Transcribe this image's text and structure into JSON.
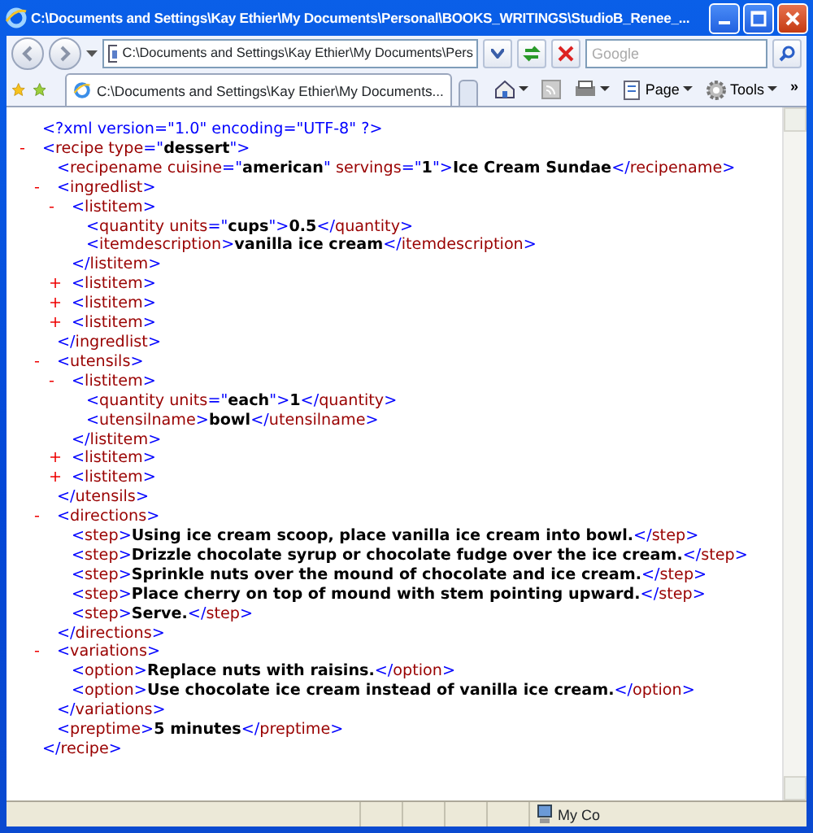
{
  "window": {
    "title": "C:\\Documents and Settings\\Kay Ethier\\My Documents\\Personal\\BOOKS_WRITINGS\\StudioB_Renee_..."
  },
  "address_bar": {
    "value": "C:\\Documents and Settings\\Kay Ethier\\My Documents\\Pers"
  },
  "search": {
    "placeholder": "Google"
  },
  "tabs": [
    {
      "label": "C:\\Documents and Settings\\Kay Ethier\\My Documents...",
      "selected": true
    }
  ],
  "command_bar": {
    "page": "Page",
    "tools": "Tools",
    "more": "»"
  },
  "syntax": {
    "open": "<",
    "close_open": "</",
    "end": ">",
    "eq": "=",
    "quote": "\"",
    "expanded": "-",
    "collapsed": "+"
  },
  "document": [
    {
      "kind": "pi",
      "text": "<?xml version=\"1.0\" encoding=\"UTF-8\" ?>"
    },
    {
      "kind": "element",
      "tag": "recipe",
      "attrs": [
        {
          "name": "type",
          "value": "dessert"
        }
      ],
      "expanded": true,
      "end_tag": "recipe",
      "children": [
        {
          "kind": "leaf",
          "tag": "recipename",
          "attrs": [
            {
              "name": "cuisine",
              "value": "american"
            },
            {
              "name": "servings",
              "value": "1"
            }
          ],
          "text": "Ice Cream Sundae",
          "end_tag": "recipename"
        },
        {
          "kind": "element",
          "tag": "ingredlist",
          "expanded": true,
          "end_tag": "ingredlist",
          "children": [
            {
              "kind": "element",
              "tag": "listitem",
              "expanded": true,
              "end_tag": "listitem",
              "children": [
                {
                  "kind": "leaf",
                  "tag": "quantity",
                  "attrs": [
                    {
                      "name": "units",
                      "value": "cups"
                    }
                  ],
                  "text": "0.5",
                  "end_tag": "quantity"
                },
                {
                  "kind": "leaf",
                  "tag": "itemdescription",
                  "text": "vanilla ice cream",
                  "end_tag": "itemdescription"
                }
              ]
            },
            {
              "kind": "element",
              "tag": "listitem",
              "expanded": false
            },
            {
              "kind": "element",
              "tag": "listitem",
              "expanded": false
            },
            {
              "kind": "element",
              "tag": "listitem",
              "expanded": false
            }
          ]
        },
        {
          "kind": "element",
          "tag": "utensils",
          "expanded": true,
          "end_tag": "utensils",
          "children": [
            {
              "kind": "element",
              "tag": "listitem",
              "expanded": true,
              "end_tag": "listitem",
              "children": [
                {
                  "kind": "leaf",
                  "tag": "quantity",
                  "attrs": [
                    {
                      "name": "units",
                      "value": "each"
                    }
                  ],
                  "text": "1",
                  "end_tag": "quantity"
                },
                {
                  "kind": "leaf",
                  "tag": "utensilname",
                  "text": "bowl",
                  "end_tag": "utensilname"
                }
              ]
            },
            {
              "kind": "element",
              "tag": "listitem",
              "expanded": false
            },
            {
              "kind": "element",
              "tag": "listitem",
              "expanded": false
            }
          ]
        },
        {
          "kind": "element",
          "tag": "directions",
          "expanded": true,
          "end_tag": "directions",
          "children": [
            {
              "kind": "leaf",
              "tag": "step",
              "text": "Using ice cream scoop, place vanilla ice cream into bowl.",
              "end_tag": "step"
            },
            {
              "kind": "leaf",
              "tag": "step",
              "text": "Drizzle chocolate syrup or chocolate fudge over the ice cream.",
              "end_tag": "step"
            },
            {
              "kind": "leaf",
              "tag": "step",
              "text": "Sprinkle nuts over the mound of chocolate and ice cream.",
              "end_tag": "step"
            },
            {
              "kind": "leaf",
              "tag": "step",
              "text": "Place cherry on top of mound with stem pointing upward.",
              "end_tag": "step"
            },
            {
              "kind": "leaf",
              "tag": "step",
              "text": "Serve.",
              "end_tag": "step"
            }
          ]
        },
        {
          "kind": "element",
          "tag": "variations",
          "expanded": true,
          "end_tag": "variations",
          "children": [
            {
              "kind": "leaf",
              "tag": "option",
              "text": "Replace nuts with raisins.",
              "end_tag": "option"
            },
            {
              "kind": "leaf",
              "tag": "option",
              "text": "Use chocolate ice cream instead of vanilla ice cream.",
              "end_tag": "option"
            }
          ]
        },
        {
          "kind": "leaf",
          "tag": "preptime",
          "text": "5 minutes",
          "end_tag": "preptime"
        }
      ]
    }
  ],
  "status_bar": {
    "zone": "My Co"
  }
}
